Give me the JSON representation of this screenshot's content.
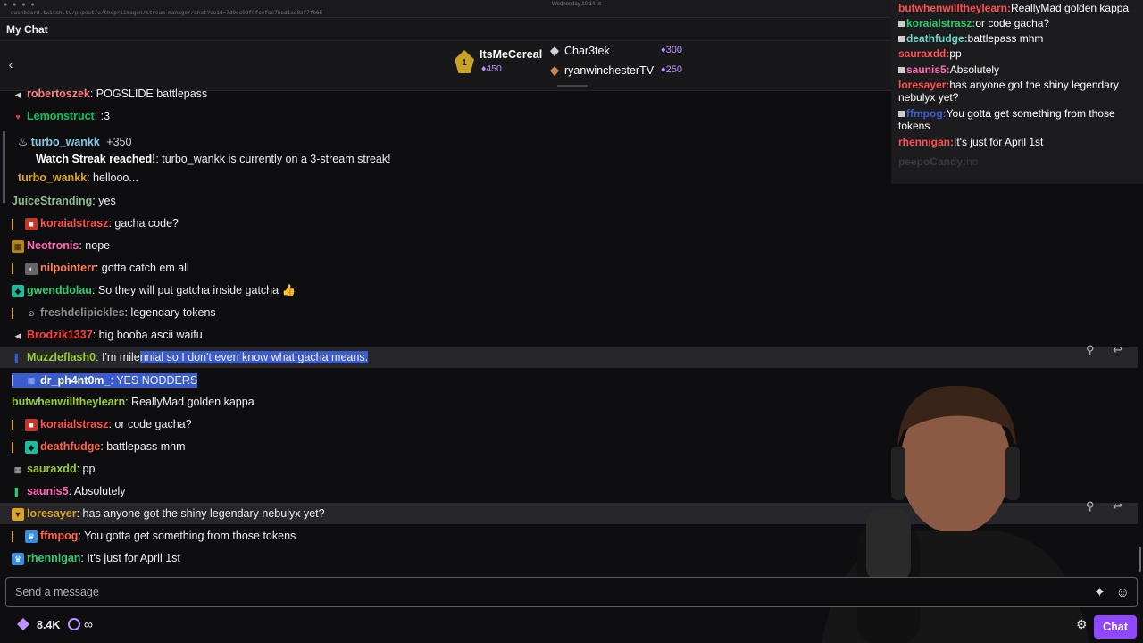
{
  "browser": {
    "url": "dashboard.twitch.tv/popout/u/thepriimagen/stream-manager/chat?uuid=7d9cc93f0fcefce7bcd1ae8af7fb65",
    "clock": "Wednesday 10:14 pt"
  },
  "header": {
    "title": "My Chat"
  },
  "leaderboard": {
    "first": {
      "rank": "1",
      "name": "ItsMeCereal",
      "points": "450"
    },
    "second": {
      "name": "Char3tek",
      "points": "300"
    },
    "third": {
      "name": "ryanwinchesterTV",
      "points": "250"
    }
  },
  "streak": {
    "user": "turbo_wankk",
    "points": "+350",
    "title": "Watch Streak reached!",
    "text": ": turbo_wankk is currently on a 3-stream streak!",
    "followup_user": "turbo_wankk",
    "followup_text": ": hellooo..."
  },
  "messages": [
    {
      "user": "robertoszek",
      "text": ": POGSLIDE battlepass",
      "color": "#ff7f7f"
    },
    {
      "user": "Lemonstruct",
      "text": ": :3",
      "color": "#00c864"
    },
    {
      "user": "JuiceStranding",
      "text": ": yes",
      "color": "#8fbc8f"
    },
    {
      "user": "koraialstrasz",
      "text": ": gacha code?",
      "color": "#ff4f4f"
    },
    {
      "user": "Neotronis",
      "text": ": nope",
      "color": "#ff69b4"
    },
    {
      "user": "nilpointerr",
      "text": ": gotta catch em all",
      "color": "#ff7f50"
    },
    {
      "user": "gwenddolau",
      "text": ": So they will put gatcha inside gatcha 👍",
      "color": "#2ecc71"
    },
    {
      "user": "freshdelipickles",
      "text": ": legendary tokens",
      "color": "#8a8a8a"
    },
    {
      "user": "Brodzik1337",
      "text": ": big booba ascii waifu",
      "color": "#ff3b3b"
    },
    {
      "user": "Muzzleflash0",
      "text_plain": ": I'm mile",
      "text_selected": "nnial so I don't even know what gacha means.",
      "color": "#9acd32"
    },
    {
      "user": "dr_ph4nt0m_",
      "text": ": YES NODDERS",
      "color": "#ffffff"
    },
    {
      "user": "butwhenwilltheylearn",
      "text": ": ReallyMad golden kappa",
      "color": "#9acd32"
    },
    {
      "user": "koraialstrasz",
      "text": ": or code gacha?",
      "color": "#ff4f4f"
    },
    {
      "user": "deathfudge",
      "text": ": battlepass mhm",
      "color": "#ff6347"
    },
    {
      "user": "sauraxdd",
      "text": ": pp",
      "color": "#9acd32"
    },
    {
      "user": "saunis5",
      "text": ": Absolutely",
      "color": "#ff69b4"
    },
    {
      "user": "loresayer",
      "text": ": has anyone got the shiny legendary nebulyx yet?",
      "color": "#daa520"
    },
    {
      "user": "ffmpog",
      "text": ": You gotta get something from those tokens",
      "color": "#ff6347"
    },
    {
      "user": "rhennigan",
      "text": ": It's just for April 1st",
      "color": "#2ecc71"
    }
  ],
  "input": {
    "placeholder": "Send a message"
  },
  "bottom": {
    "points": "8.4K",
    "infinity": "∞",
    "chat_button": "Chat"
  },
  "overlay": [
    {
      "user": "butwhenwilltheylearn:",
      "text": "ReallyMad golden kappa",
      "color": "#ff4f4f"
    },
    {
      "user": "koraialstrasz:",
      "text": "or code gacha?",
      "color": "#2ecc71"
    },
    {
      "user": "deathfudge:",
      "text": "battlepass mhm",
      "color": "#6dd5c7"
    },
    {
      "user": "sauraxdd:",
      "text": "pp",
      "color": "#ff4f4f"
    },
    {
      "user": "saunis5:",
      "text": "Absolutely",
      "color": "#ff69b4"
    },
    {
      "user": "loresayer:",
      "text": "has anyone got the shiny legendary nebulyx yet?",
      "color": "#ff4f4f"
    },
    {
      "user": "ffmpog:",
      "text": "You gotta get something from those tokens",
      "color": "#3b5ccc"
    },
    {
      "user": "rhennigan:",
      "text": "It's just for April 1st",
      "color": "#ff4f4f"
    },
    {
      "user": "peepoCandy:",
      "text": "no",
      "color": "#3a3a3e"
    }
  ]
}
